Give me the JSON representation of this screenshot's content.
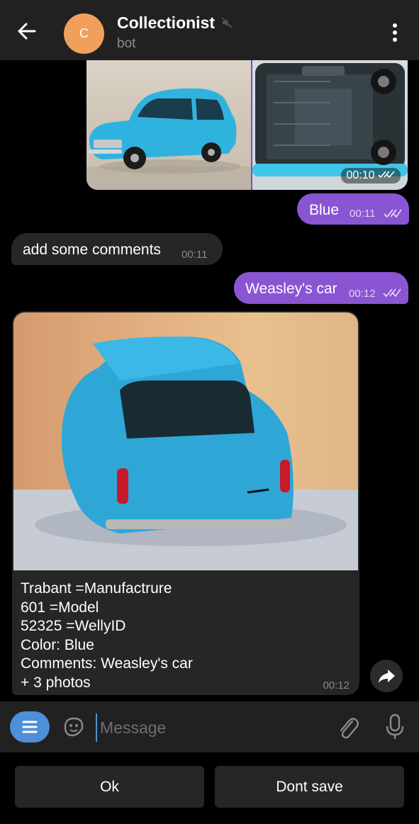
{
  "header": {
    "avatar_letter": "C",
    "avatar_color": "#f0a05a",
    "title": "Collectionist",
    "subtitle": "bot",
    "icons": [
      "back-arrow-icon",
      "muted-icon",
      "more-vertical-icon"
    ]
  },
  "messages": {
    "album": {
      "time": "00:10"
    },
    "blue": {
      "text": "Blue",
      "time": "00:11"
    },
    "comments": {
      "text": "add some comments",
      "time": "00:11"
    },
    "weasley": {
      "text": "Weasley's car",
      "time": "00:12"
    },
    "card": {
      "lines": [
        "Trabant =Manufactrure",
        "601 =Model",
        "52325 =WellyID",
        "Color: Blue",
        "Comments: Weasley's car",
        "+ 3 photos"
      ],
      "time": "00:12"
    }
  },
  "composer": {
    "placeholder": "Message",
    "icons": [
      "bot-menu-icon",
      "sticker-icon",
      "attach-icon",
      "microphone-icon"
    ]
  },
  "keyboard": {
    "buttons": [
      "Ok",
      "Dont save"
    ]
  },
  "colors": {
    "outgoing_bubble": "#8a55d3",
    "incoming_bubble": "#262626",
    "accent": "#4d8fd8"
  }
}
